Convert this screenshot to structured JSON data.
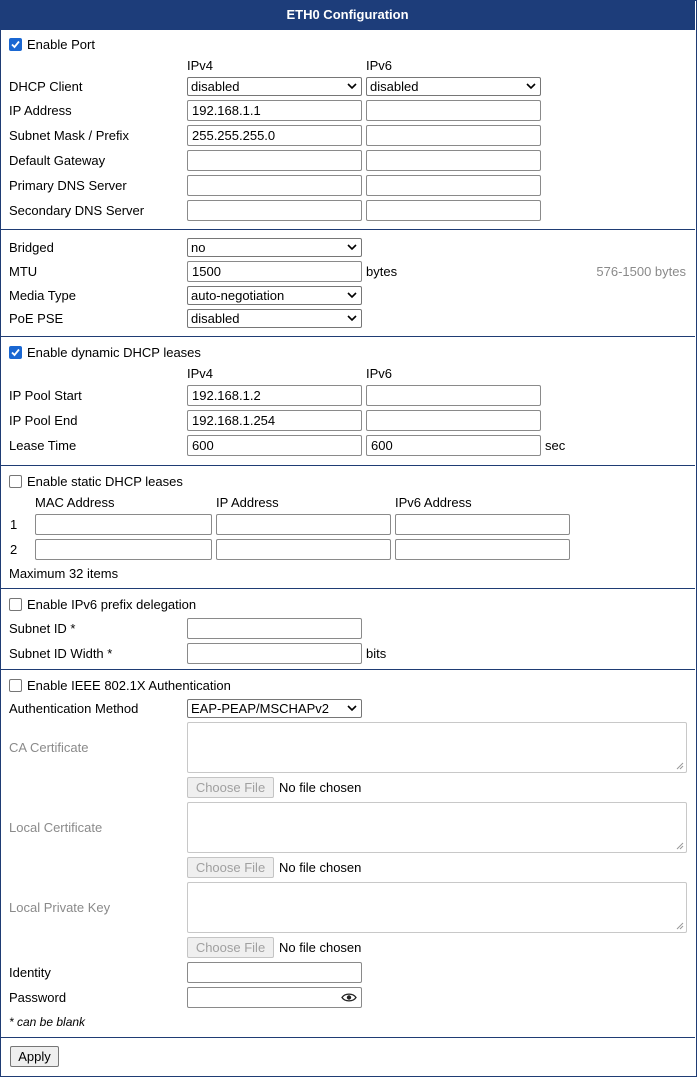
{
  "title": "ETH0 Configuration",
  "port": {
    "enable_label": "Enable Port",
    "enabled": true,
    "col_ipv4": "IPv4",
    "col_ipv6": "IPv6",
    "dhcp_client_label": "DHCP Client",
    "dhcp_client_ipv4": "disabled",
    "dhcp_client_ipv6": "disabled",
    "ip_address_label": "IP Address",
    "ip_address_ipv4": "192.168.1.1",
    "ip_address_ipv6": "",
    "subnet_label": "Subnet Mask / Prefix",
    "subnet_ipv4": "255.255.255.0",
    "subnet_ipv6": "",
    "gateway_label": "Default Gateway",
    "gateway_ipv4": "",
    "gateway_ipv6": "",
    "dns1_label": "Primary DNS Server",
    "dns1_ipv4": "",
    "dns1_ipv6": "",
    "dns2_label": "Secondary DNS Server",
    "dns2_ipv4": "",
    "dns2_ipv6": ""
  },
  "link": {
    "bridged_label": "Bridged",
    "bridged_value": "no",
    "mtu_label": "MTU",
    "mtu_value": "1500",
    "mtu_unit": "bytes",
    "mtu_range": "576-1500 bytes",
    "media_label": "Media Type",
    "media_value": "auto-negotiation",
    "poe_label": "PoE PSE",
    "poe_value": "disabled"
  },
  "dynamic_dhcp": {
    "enable_label": "Enable dynamic DHCP leases",
    "enabled": true,
    "col_ipv4": "IPv4",
    "col_ipv6": "IPv6",
    "pool_start_label": "IP Pool Start",
    "pool_start_ipv4": "192.168.1.2",
    "pool_start_ipv6": "",
    "pool_end_label": "IP Pool End",
    "pool_end_ipv4": "192.168.1.254",
    "pool_end_ipv6": "",
    "lease_label": "Lease Time",
    "lease_ipv4": "600",
    "lease_ipv6": "600",
    "lease_unit": "sec"
  },
  "static_dhcp": {
    "enable_label": "Enable static DHCP leases",
    "enabled": false,
    "col_mac": "MAC Address",
    "col_ip": "IP Address",
    "col_ipv6": "IPv6 Address",
    "rows": [
      {
        "index": "1",
        "mac": "",
        "ip": "",
        "ipv6": ""
      },
      {
        "index": "2",
        "mac": "",
        "ip": "",
        "ipv6": ""
      }
    ],
    "max_note": "Maximum 32 items"
  },
  "prefix_delegation": {
    "enable_label": "Enable IPv6 prefix delegation",
    "enabled": false,
    "subnet_id_label": "Subnet ID *",
    "subnet_id_value": "",
    "subnet_width_label": "Subnet ID Width *",
    "subnet_width_value": "",
    "subnet_width_unit": "bits"
  },
  "auth": {
    "enable_label": "Enable IEEE 802.1X Authentication",
    "enabled": false,
    "method_label": "Authentication Method",
    "method_value": "EAP-PEAP/MSCHAPv2",
    "ca_label": "CA Certificate",
    "local_cert_label": "Local Certificate",
    "private_key_label": "Local Private Key",
    "choose_file": "Choose File",
    "no_file": "No file chosen",
    "identity_label": "Identity",
    "identity_value": "",
    "password_label": "Password",
    "password_value": "",
    "blank_note": "* can be blank"
  },
  "apply_label": "Apply",
  "colors": {
    "header_bg": "#1d3d7a",
    "checkbox_on": "#1a67d2"
  }
}
